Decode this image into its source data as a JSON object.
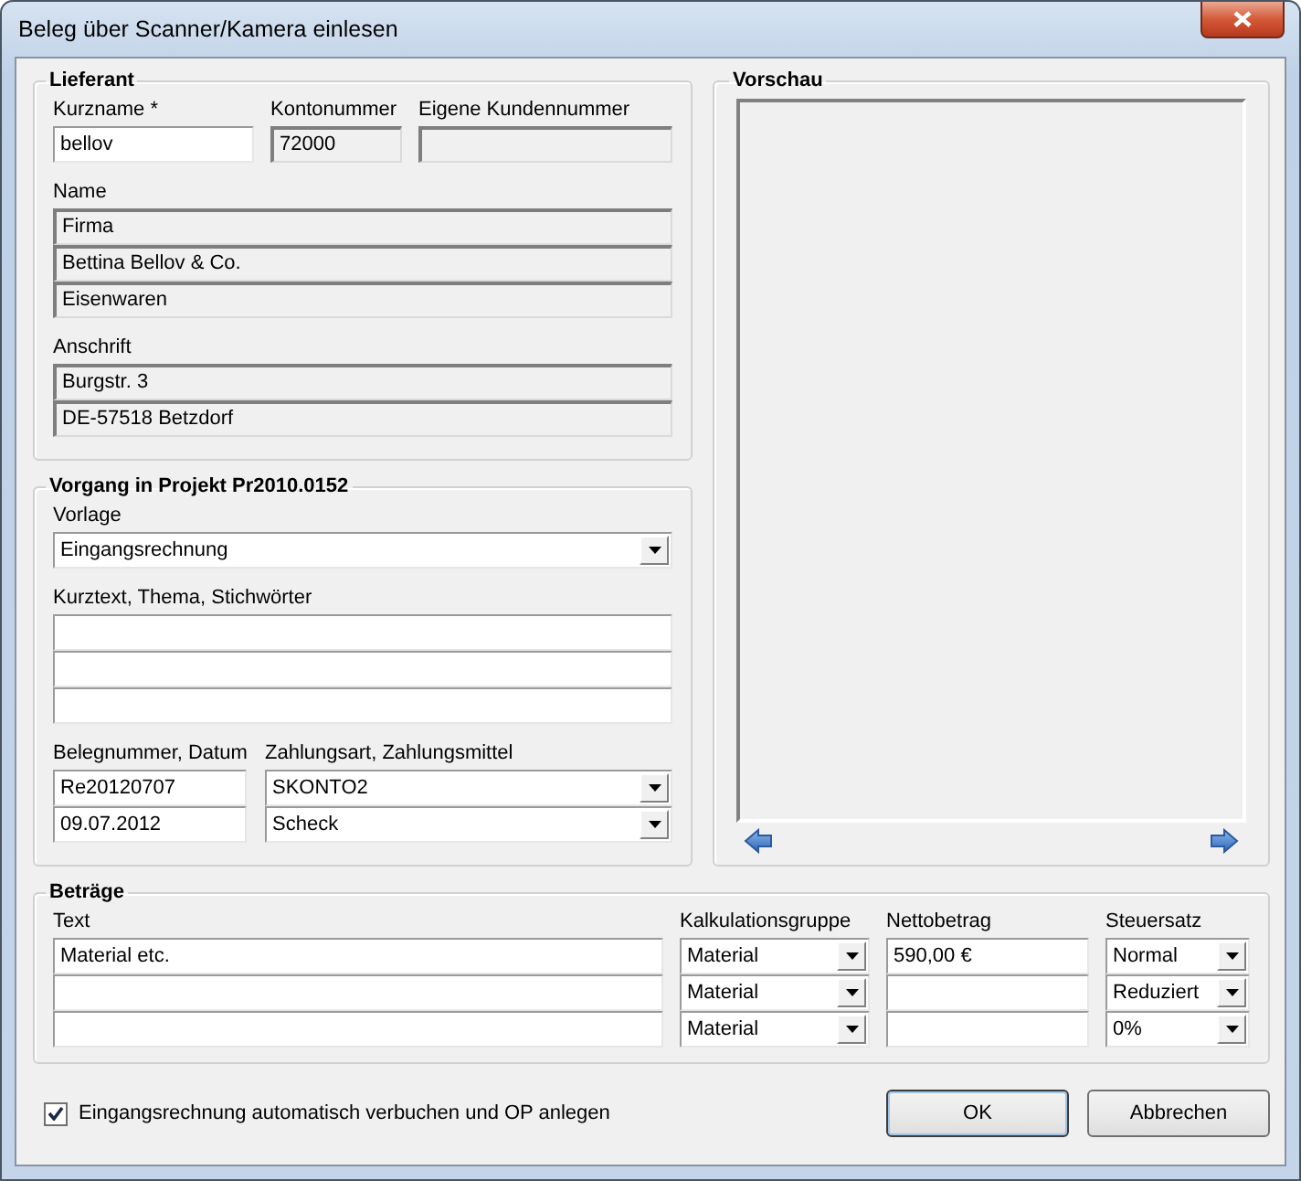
{
  "window": {
    "title": "Beleg über Scanner/Kamera einlesen"
  },
  "lieferant": {
    "title": "Lieferant",
    "fields": [
      {
        "label": "Kurzname *",
        "value": "bellov",
        "readonly": false
      },
      {
        "label": "Kontonummer",
        "value": "72000",
        "readonly": true
      },
      {
        "label": "Eigene Kundennummer",
        "readonly": true
      }
    ],
    "name": {
      "label": "Name",
      "lines": [
        {
          "value": "Firma",
          "readonly": true
        },
        {
          "value": "Bettina Bellov & Co.",
          "readonly": true
        },
        {
          "value": "Eisenwaren",
          "readonly": true
        }
      ]
    },
    "anschrift": {
      "label": "Anschrift",
      "lines": [
        {
          "value": "Burgstr. 3",
          "readonly": true
        },
        {
          "value": "DE-57518 Betzdorf",
          "readonly": true
        }
      ]
    }
  },
  "vorgang": {
    "title": "Vorgang in Projekt Pr2010.0152",
    "vorlage": {
      "label": "Vorlage",
      "value": "Eingangsrechnung"
    },
    "kurztext": {
      "label": "Kurztext, Thema, Stichwörter",
      "lines": [
        {
          "readonly": false
        },
        {
          "readonly": false
        },
        {
          "readonly": false
        }
      ]
    },
    "beleg": {
      "label": "Belegnummer, Datum",
      "fields": [
        {
          "value": "Re20120707",
          "readonly": false
        },
        {
          "value": "09.07.2012",
          "readonly": false
        }
      ]
    },
    "zahlung": {
      "label": "Zahlungsart, Zahlungsmittel",
      "dropdowns": [
        {
          "value": "SKONTO2"
        },
        {
          "value": "Scheck"
        }
      ]
    }
  },
  "vorschau": {
    "title": "Vorschau"
  },
  "betraege": {
    "title": "Beträge",
    "columns": [
      "Text",
      "Kalkulationsgruppe",
      "Nettobetrag",
      "Steuersatz"
    ],
    "rows": [
      {
        "text": "Material etc.",
        "gruppe": "Material",
        "netto": "590,00 €",
        "steuer": "Normal"
      },
      {
        "gruppe": "Material",
        "steuer": "Reduziert"
      },
      {
        "gruppe": "Material",
        "steuer": "0%"
      }
    ]
  },
  "checkbox": {
    "label": "Eingangsrechnung automatisch verbuchen und OP anlegen",
    "checked": true
  },
  "buttons": [
    {
      "label": "OK",
      "default": true
    },
    {
      "label": "Abbrechen",
      "default": false
    }
  ]
}
